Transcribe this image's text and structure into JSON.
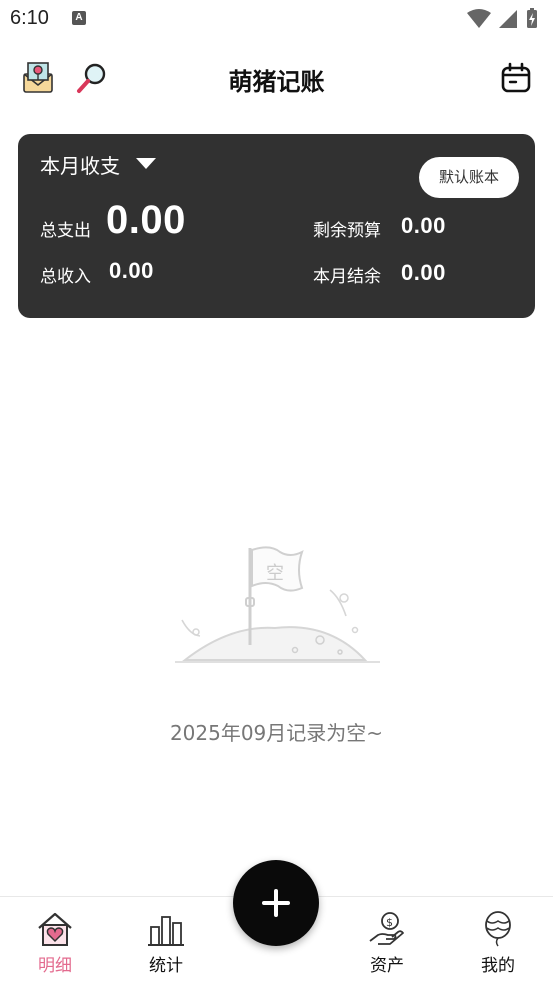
{
  "status": {
    "time": "6:10",
    "notification_glyph": "A"
  },
  "app": {
    "title": "萌猪记账"
  },
  "summary": {
    "period_label": "本月收支",
    "book_button": "默认账本",
    "total_expense_label": "总支出",
    "total_expense_value": "0.00",
    "total_income_label": "总收入",
    "total_income_value": "0.00",
    "remaining_budget_label": "剩余预算",
    "remaining_budget_value": "0.00",
    "month_balance_label": "本月结余",
    "month_balance_value": "0.00"
  },
  "empty_state": {
    "flag_text": "空",
    "message": "2025年09月记录为空~"
  },
  "nav": {
    "items": [
      {
        "label": "明细",
        "icon": "home-heart-icon",
        "active": true
      },
      {
        "label": "统计",
        "icon": "bar-chart-icon",
        "active": false
      },
      {
        "label": "资产",
        "icon": "hand-coin-icon",
        "active": false
      },
      {
        "label": "我的",
        "icon": "balloon-icon",
        "active": false
      }
    ],
    "fab_icon": "plus-icon"
  },
  "colors": {
    "card_bg": "#313131",
    "active_tab": "#e36a8e",
    "fab_bg": "#0a0a0a"
  }
}
